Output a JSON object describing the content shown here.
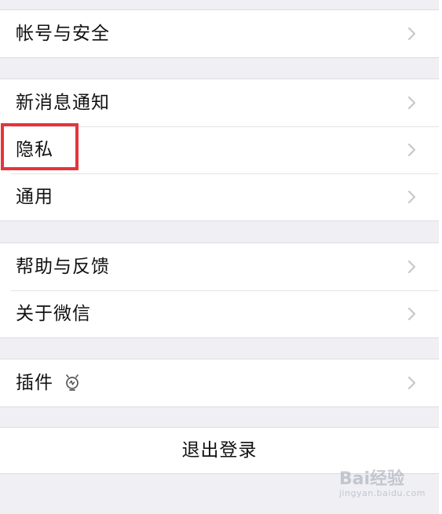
{
  "settings": {
    "groups": [
      {
        "items": [
          {
            "label": "帐号与安全"
          }
        ]
      },
      {
        "items": [
          {
            "label": "新消息通知"
          },
          {
            "label": "隐私"
          },
          {
            "label": "通用"
          }
        ]
      },
      {
        "items": [
          {
            "label": "帮助与反馈"
          },
          {
            "label": "关于微信"
          }
        ]
      },
      {
        "items": [
          {
            "label": "插件",
            "icon": "lightbulb-icon"
          }
        ]
      }
    ],
    "logout_label": "退出登录"
  },
  "annotation": {
    "highlight_color": "#e6343a"
  },
  "watermark": {
    "brand_text": "Bai经验",
    "url_text": "jingyan.baidu.com"
  },
  "colors": {
    "background": "#efeff4",
    "cell_background": "#ffffff",
    "chevron": "#c7c7cc"
  }
}
